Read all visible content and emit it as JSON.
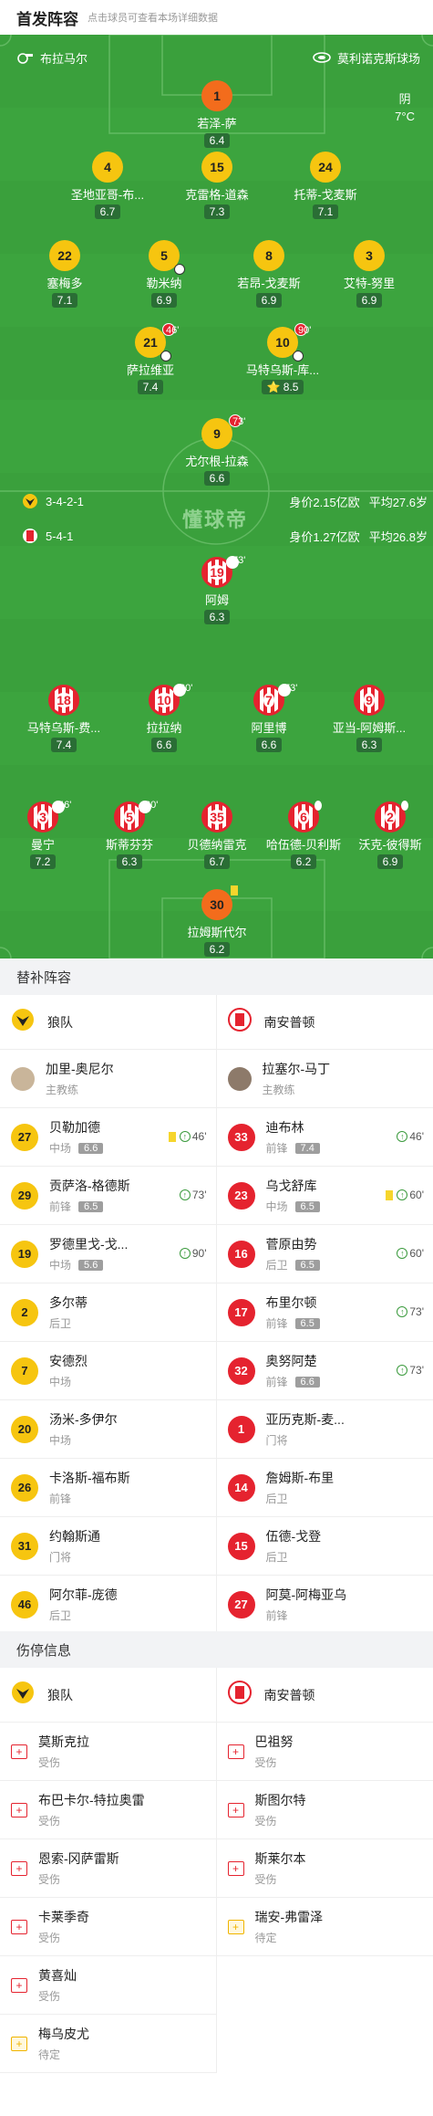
{
  "header": {
    "title": "首发阵容",
    "hint": "点击球员可查看本场详细数据"
  },
  "match": {
    "referee": "布拉马尔",
    "venue": "莫利诺克斯球场",
    "weather": "阴",
    "temperature": "7°C"
  },
  "home": {
    "name": "狼队",
    "formation": "3-4-2-1",
    "value": "身价2.15亿欧",
    "age": "平均27.6岁"
  },
  "away": {
    "name": "南安普顿",
    "formation": "5-4-1",
    "value": "身价1.27亿欧",
    "age": "平均26.8岁"
  },
  "watermark": "懂球帝",
  "home_lineup": [
    {
      "num": "1",
      "name": "若泽-萨",
      "rating": "6.4"
    },
    {
      "num": "4",
      "name": "圣地亚哥-布...",
      "rating": "6.7"
    },
    {
      "num": "15",
      "name": "克雷格-道森",
      "rating": "7.3"
    },
    {
      "num": "24",
      "name": "托蒂-戈麦斯",
      "rating": "7.1"
    },
    {
      "num": "22",
      "name": "塞梅多",
      "rating": "7.1"
    },
    {
      "num": "5",
      "name": "勒米纳",
      "rating": "6.9"
    },
    {
      "num": "8",
      "name": "若昂-戈麦斯",
      "rating": "6.9"
    },
    {
      "num": "3",
      "name": "艾特-努里",
      "rating": "6.9"
    },
    {
      "num": "21",
      "name": "萨拉维亚",
      "rating": "7.4",
      "sub": "46'"
    },
    {
      "num": "10",
      "name": "马特乌斯-库...",
      "rating": "8.5",
      "sub": "90'"
    },
    {
      "num": "9",
      "name": "尤尔根-拉森",
      "rating": "6.6",
      "sub": "73'"
    }
  ],
  "away_lineup": [
    {
      "num": "19",
      "name": "阿姆",
      "rating": "6.3",
      "sub": "73'"
    },
    {
      "num": "18",
      "name": "马特乌斯-费...",
      "rating": "7.4"
    },
    {
      "num": "10",
      "name": "拉拉纳",
      "rating": "6.6",
      "sub": "60'"
    },
    {
      "num": "7",
      "name": "阿里博",
      "rating": "6.6",
      "sub": "73'"
    },
    {
      "num": "9",
      "name": "亚当-阿姆斯...",
      "rating": "6.3"
    },
    {
      "num": "3",
      "name": "曼宁",
      "rating": "7.2",
      "sub": "46'"
    },
    {
      "num": "5",
      "name": "斯蒂芬芬",
      "rating": "6.3",
      "sub": "60'"
    },
    {
      "num": "35",
      "name": "贝德纳雷克",
      "rating": "6.7"
    },
    {
      "num": "6",
      "name": "哈伍德-贝利斯",
      "rating": "6.2"
    },
    {
      "num": "2",
      "name": "沃克-彼得斯",
      "rating": "6.9"
    },
    {
      "num": "30",
      "name": "拉姆斯代尔",
      "rating": "6.2"
    }
  ],
  "subs_title": "替补阵容",
  "subs": {
    "home_team": "狼队",
    "away_team": "南安普顿",
    "home_coach": {
      "name": "加里-奥尼尔",
      "role": "主教练"
    },
    "away_coach": {
      "name": "拉塞尔-马丁",
      "role": "主教练"
    },
    "home": [
      {
        "num": "27",
        "name": "贝勒加德",
        "pos": "中场",
        "rating": "6.6",
        "time": "46'",
        "yellow": true
      },
      {
        "num": "29",
        "name": "贡萨洛-格德斯",
        "pos": "前锋",
        "rating": "6.5",
        "time": "73'"
      },
      {
        "num": "19",
        "name": "罗德里戈-戈...",
        "pos": "中场",
        "rating": "5.6",
        "time": "90'"
      },
      {
        "num": "2",
        "name": "多尔蒂",
        "pos": "后卫"
      },
      {
        "num": "7",
        "name": "安德烈",
        "pos": "中场"
      },
      {
        "num": "20",
        "name": "汤米-多伊尔",
        "pos": "中场"
      },
      {
        "num": "26",
        "name": "卡洛斯-福布斯",
        "pos": "前锋"
      },
      {
        "num": "31",
        "name": "约翰斯通",
        "pos": "门将"
      },
      {
        "num": "46",
        "name": "阿尔菲-庞德",
        "pos": "后卫"
      }
    ],
    "away": [
      {
        "num": "33",
        "name": "迪布林",
        "pos": "前锋",
        "rating": "7.4",
        "time": "46'"
      },
      {
        "num": "23",
        "name": "乌戈舒库",
        "pos": "中场",
        "rating": "6.5",
        "time": "60'",
        "yellow": true
      },
      {
        "num": "16",
        "name": "菅原由势",
        "pos": "后卫",
        "rating": "6.5",
        "time": "60'"
      },
      {
        "num": "17",
        "name": "布里尔顿",
        "pos": "前锋",
        "rating": "6.5",
        "time": "73'"
      },
      {
        "num": "32",
        "name": "奥努阿楚",
        "pos": "前锋",
        "rating": "6.6",
        "time": "73'"
      },
      {
        "num": "1",
        "name": "亚历克斯-麦...",
        "pos": "门将"
      },
      {
        "num": "14",
        "name": "詹姆斯-布里",
        "pos": "后卫"
      },
      {
        "num": "15",
        "name": "伍德-戈登",
        "pos": "后卫"
      },
      {
        "num": "27",
        "name": "阿莫-阿梅亚乌",
        "pos": "前锋"
      }
    ]
  },
  "injury_title": "伤停信息",
  "injuries": {
    "home": [
      {
        "name": "莫斯克拉",
        "status": "受伤"
      },
      {
        "name": "布巴卡尔-特拉奥雷",
        "status": "受伤"
      },
      {
        "name": "恩索-冈萨雷斯",
        "status": "受伤"
      },
      {
        "name": "卡莱季奇",
        "status": "受伤"
      },
      {
        "name": "黄喜灿",
        "status": "受伤"
      },
      {
        "name": "梅乌皮尤",
        "status": "待定"
      }
    ],
    "away": [
      {
        "name": "巴祖努",
        "status": "受伤"
      },
      {
        "name": "斯图尔特",
        "status": "受伤"
      },
      {
        "name": "斯莱尔本",
        "status": "受伤"
      },
      {
        "name": "瑞安-弗雷泽",
        "status": "待定"
      }
    ]
  }
}
